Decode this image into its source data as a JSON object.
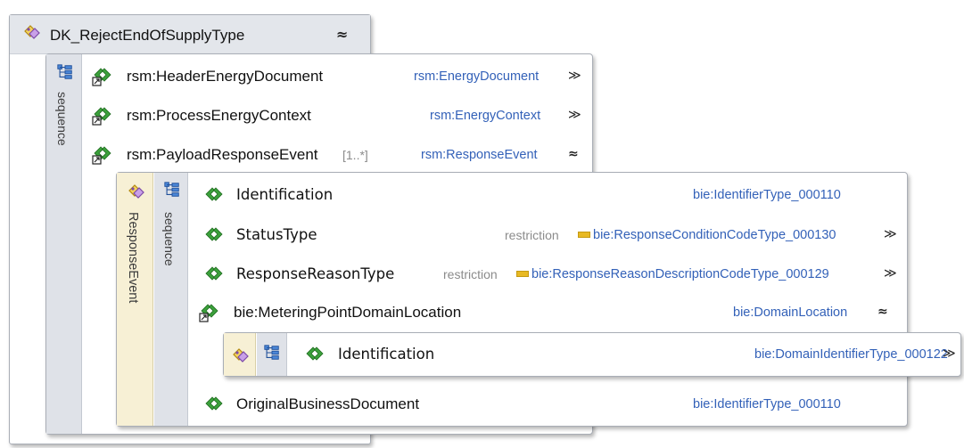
{
  "root": {
    "title": "DK_RejectEndOfSupplyType",
    "collapse_glyph": "≈"
  },
  "sequence_1": {
    "label": "sequence",
    "elements": [
      {
        "name": "rsm:HeaderEnergyDocument",
        "type": "rsm:EnergyDocument",
        "toggle": "≫"
      },
      {
        "name": "rsm:ProcessEnergyContext",
        "type": "rsm:EnergyContext",
        "toggle": "≫"
      },
      {
        "name": "rsm:PayloadResponseEvent",
        "cardinality": "[1..*]",
        "type": "rsm:ResponseEvent",
        "toggle": "≈"
      }
    ]
  },
  "response_event": {
    "label": "ResponseEvent",
    "sequence_label": "sequence",
    "elements": [
      {
        "name": "Identification",
        "type": "bie:IdentifierType_000110"
      },
      {
        "name": "StatusType",
        "restriction": "restriction",
        "type": "bie:ResponseConditionCodeType_000130",
        "toggle": "≫"
      },
      {
        "name": "ResponseReasonType",
        "restriction": "restriction",
        "type": "bie:ResponseReasonDescriptionCodeType_000129",
        "toggle": "≫"
      },
      {
        "name": "bie:MeteringPointDomainLocation",
        "type": "bie:DomainLocation",
        "toggle": "≈"
      },
      {
        "name": "OriginalBusinessDocument",
        "type": "bie:IdentifierType_000110"
      }
    ]
  },
  "domain_location": {
    "element": {
      "name": "Identification",
      "type": "bie:DomainIdentifierType_000122",
      "toggle": "≫"
    }
  },
  "icons": {
    "complex_type": "complex-type-icon",
    "sequence": "sequence-icon",
    "element": "element-icon",
    "referenced_element": "referenced-element-icon"
  },
  "colors": {
    "type_text": "#3361b8",
    "element_green": "#2e9a2e",
    "sequence_blue": "#3a72c8",
    "restriction_yellow": "#e8b923"
  }
}
